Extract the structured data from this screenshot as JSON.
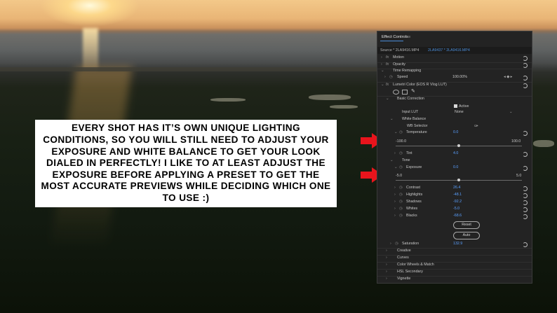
{
  "callout": {
    "text": "EVERY SHOT HAS IT’S OWN UNIQUE LIGHTING CONDITIONS, SO YOU WILL STILL NEED TO ADJUST YOUR EXPOSURE AND WHITE BALANCE TO GET YOUR LOOK DIALED IN PERFECTLY! I LIKE TO AT LEAST ADJUST THE EXPOSURE BEFORE APPLYING A PRESET TO GET THE MOST ACCURATE PREVIEWS WHILE DECIDING WHICH ONE TO USE :)"
  },
  "panel": {
    "title": "Effect Controls",
    "menu_icon": "≡",
    "source": "Source * 2LA9416.MP4",
    "clip": "2LA9437 * 2LA9416.MP4",
    "motion": "Motion",
    "opacity": "Opacity",
    "time_remapping": "Time Remapping",
    "speed_label": "Speed",
    "speed_value": "100.00%",
    "lumetri": "Lumetri Color (EOS R Vlog LUT)",
    "basic_correction": "Basic Correction",
    "active_label": "Active",
    "input_lut_label": "Input LUT",
    "input_lut_value": "None",
    "white_balance": "White Balance",
    "wb_selector": "WB Selector",
    "temperature_label": "Temperature",
    "temperature_value": "0.0",
    "temp_min": "-100.0",
    "temp_max": "100.0",
    "tint_label": "Tint",
    "tint_value": "4.0",
    "tone": "Tone",
    "exposure_label": "Exposure",
    "exposure_value": "0.0",
    "exp_min": "-5.0",
    "exp_max": "5.0",
    "contrast_label": "Contrast",
    "contrast_value": "26.4",
    "highlights_label": "Highlights",
    "highlights_value": "-48.1",
    "shadows_label": "Shadows",
    "shadows_value": "-92.2",
    "whites_label": "Whites",
    "whites_value": "-5.0",
    "blacks_label": "Blacks",
    "blacks_value": "-68.6",
    "reset_button": "Reset",
    "auto_button": "Auto",
    "saturation_label": "Saturation",
    "saturation_value": "132.9",
    "creative": "Creative",
    "curves": "Curves",
    "color_wheels": "Color Wheels & Match",
    "hsl_secondary": "HSL Secondary",
    "vignette": "Vignette",
    "fx": "fx"
  },
  "colors": {
    "accent_blue": "#5aa0ff",
    "arrow_red": "#e8141c",
    "panel_bg": "#232323"
  }
}
